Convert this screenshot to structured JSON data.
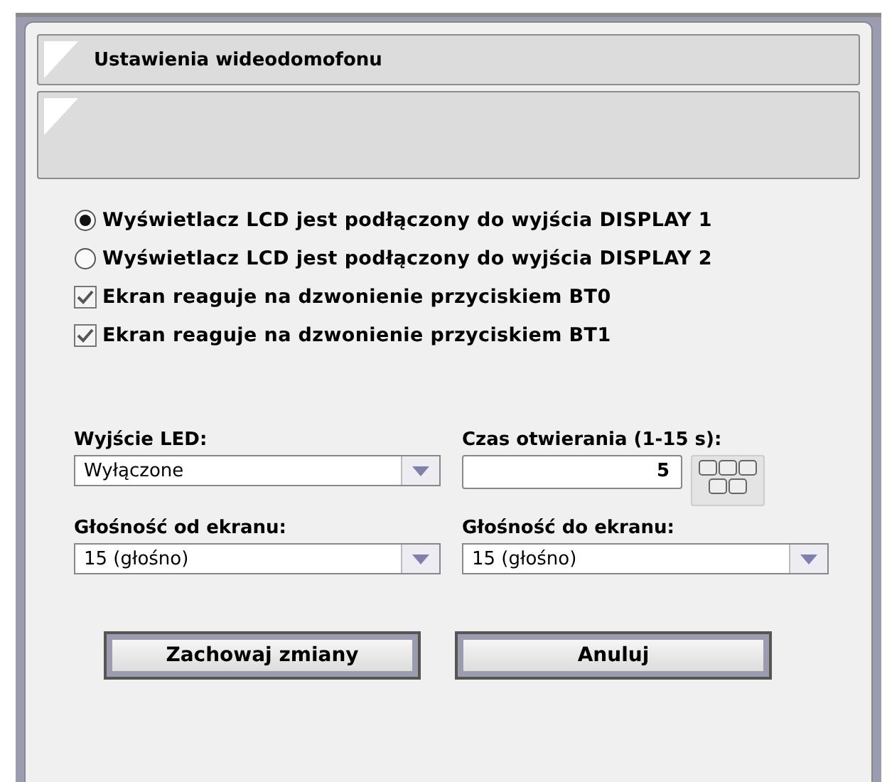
{
  "panel_title": "Ustawienia wideodomofonu",
  "options": [
    {
      "kind": "radio",
      "label": "Wyświetlacz LCD jest podłączony do wyjścia DISPLAY 1",
      "selected": true
    },
    {
      "kind": "radio",
      "label": "Wyświetlacz LCD jest podłączony do wyjścia DISPLAY 2",
      "selected": false
    },
    {
      "kind": "checkbox",
      "label": "Ekran reaguje na dzwonienie przyciskiem BT0",
      "checked": true
    },
    {
      "kind": "checkbox",
      "label": "Ekran reaguje na dzwonienie przyciskiem BT1",
      "checked": true
    }
  ],
  "fields": [
    {
      "kind": "select",
      "label": "Wyjście LED:",
      "value": "Wyłączone"
    },
    {
      "kind": "number",
      "label": "Czas otwierania (1-15 s):",
      "value": "5"
    },
    {
      "kind": "select",
      "label": "Głośność od ekranu:",
      "value": "15 (głośno)"
    },
    {
      "kind": "select",
      "label": "Głośność do ekranu:",
      "value": "15 (głośno)"
    }
  ],
  "buttons": [
    "Zachowaj zmiany",
    "Anuluj"
  ]
}
